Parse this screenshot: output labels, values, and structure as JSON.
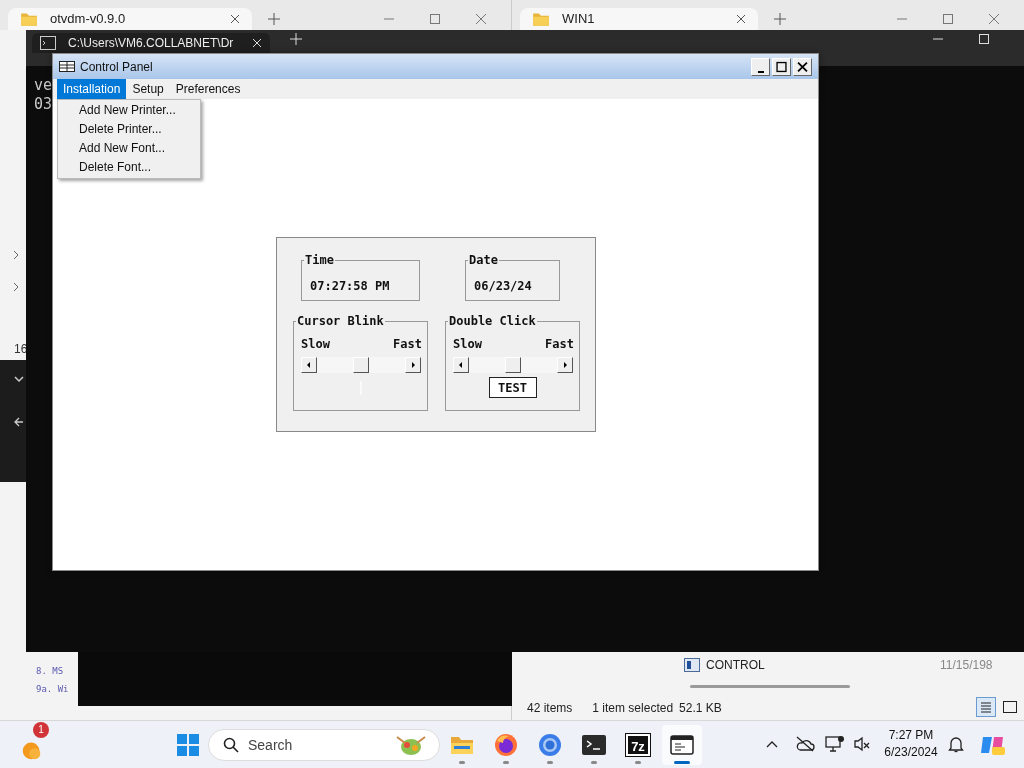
{
  "background_windows": {
    "explorer_left": {
      "tab": "otvdm-v0.9.0",
      "partial_text": "16",
      "list_items": [
        "8. MS",
        "9a. Wi"
      ]
    },
    "explorer_right": {
      "tab": "WIN1",
      "file_row": {
        "name": "CONTROL",
        "date": "11/15/198"
      },
      "status_bar": {
        "items": "42 items",
        "selection": "1 item selected",
        "size": "52.1 KB"
      }
    },
    "terminal": {
      "tab": "C:\\Users\\VM6.COLLABNET\\Dr",
      "lines": [
        "ve",
        "03"
      ]
    }
  },
  "control_panel": {
    "title": "Control Panel",
    "menus": [
      {
        "label": "Installation",
        "selected": true
      },
      {
        "label": "Setup",
        "selected": false
      },
      {
        "label": "Preferences",
        "selected": false
      }
    ],
    "menu_items": [
      "Add New Printer...",
      "Delete Printer...",
      "Add New Font...",
      "Delete Font..."
    ],
    "time": {
      "label": "Time",
      "value": "07:27:58 PM"
    },
    "date": {
      "label": "Date",
      "value": "06/23/24"
    },
    "cursor_blink": {
      "label": "Cursor Blink",
      "slow": "Slow",
      "fast": "Fast",
      "level": 0.5
    },
    "double_click": {
      "label": "Double Click",
      "slow": "Slow",
      "fast": "Fast",
      "level": 0.5,
      "test_button": "TEST"
    }
  },
  "taskbar": {
    "notification_badge": "1",
    "search_placeholder": "Search",
    "apps": [
      {
        "kind": "explorer",
        "active": false
      },
      {
        "kind": "firefox",
        "active": false
      },
      {
        "kind": "chrome",
        "active": false
      },
      {
        "kind": "terminal",
        "active": false
      },
      {
        "kind": "archiver",
        "label": "7z",
        "active": false
      },
      {
        "kind": "app",
        "active": true
      }
    ],
    "clock": {
      "time": "7:27 PM",
      "date": "6/23/2024"
    }
  }
}
